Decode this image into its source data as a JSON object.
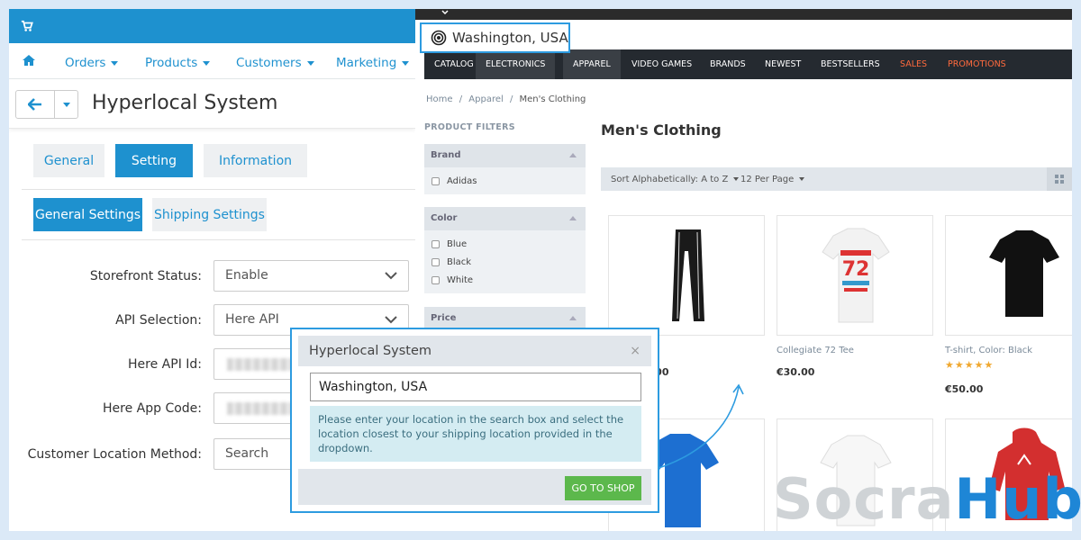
{
  "admin": {
    "nav": [
      "Orders",
      "Products",
      "Customers",
      "Marketing"
    ],
    "title": "Hyperlocal System",
    "tabs": [
      "General",
      "Setting",
      "Information"
    ],
    "subtabs": [
      "General Settings",
      "Shipping Settings"
    ],
    "form": {
      "storefront_status_label": "Storefront Status:",
      "storefront_status_value": "Enable",
      "api_selection_label": "API Selection:",
      "api_selection_value": "Here API",
      "here_api_id_label": "Here API Id:",
      "here_app_code_label": "Here App Code:",
      "customer_location_label": "Customer Location Method:",
      "customer_location_value": "Search"
    }
  },
  "store": {
    "location": "Washington, USA",
    "nav": [
      "CATALOG",
      "ELECTRONICS",
      "APPAREL",
      "VIDEO GAMES",
      "BRANDS",
      "NEWEST",
      "BESTSELLERS",
      "SALES",
      "PROMOTIONS"
    ],
    "breadcrumb": [
      "Home",
      "Apparel",
      "Men's Clothing"
    ],
    "breadcrumb_sep": "/",
    "filters": {
      "heading": "PRODUCT FILTERS",
      "brand": "Brand",
      "brand_opts": [
        "Adidas"
      ],
      "color": "Color",
      "color_opts": [
        "Blue",
        "Black",
        "White"
      ],
      "price": "Price"
    },
    "section_title": "Men's Clothing",
    "sort": "Sort Alphabetically: A to Z",
    "per_page": "12 Per Page",
    "products": [
      {
        "name": "",
        "price": ".00"
      },
      {
        "name": "Collegiate 72 Tee",
        "price": "€30.00"
      },
      {
        "name": "T-shirt, Color: Black",
        "price": "€50.00",
        "stars": "★★★★★"
      }
    ]
  },
  "modal": {
    "title": "Hyperlocal System",
    "close": "×",
    "input_value": "Washington, USA",
    "info": "Please enter your location in the search box and select the location closest to your shipping location provided in the dropdown.",
    "button": "GO TO SHOP"
  },
  "watermark": {
    "part1": "Socra",
    "part2": "Hub"
  },
  "colors": {
    "admin_blue": "#1e91cf",
    "highlight": "#2d9be0",
    "go_green": "#5cb84c",
    "sale_orange": "#ff6a3d"
  }
}
